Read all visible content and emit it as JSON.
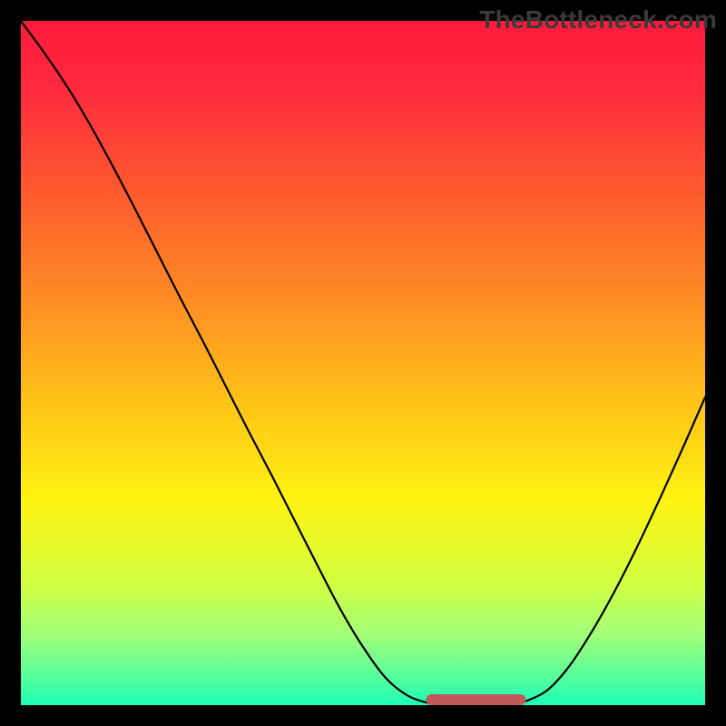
{
  "watermark": "TheBottleneck.com",
  "chart_data": {
    "type": "line",
    "title": "",
    "xlabel": "",
    "ylabel": "",
    "xlim": [
      0,
      100
    ],
    "ylim": [
      0,
      100
    ],
    "grid": false,
    "background_gradient": {
      "stops": [
        {
          "offset": 0.0,
          "color": "#ff1a3c"
        },
        {
          "offset": 0.1,
          "color": "#ff2a3e"
        },
        {
          "offset": 0.25,
          "color": "#ff5a2e"
        },
        {
          "offset": 0.4,
          "color": "#ff8a25"
        },
        {
          "offset": 0.55,
          "color": "#ffc018"
        },
        {
          "offset": 0.7,
          "color": "#fff312"
        },
        {
          "offset": 0.82,
          "color": "#d3ff40"
        },
        {
          "offset": 0.9,
          "color": "#9fff7a"
        },
        {
          "offset": 0.965,
          "color": "#4effa0"
        },
        {
          "offset": 1.0,
          "color": "#1dffb8"
        }
      ]
    },
    "series": [
      {
        "name": "bottleneck-curve",
        "color": "#000000",
        "x": [
          0.0,
          3.3,
          6.7,
          10.0,
          13.3,
          16.7,
          20.0,
          23.3,
          26.7,
          30.0,
          33.3,
          36.7,
          40.0,
          43.3,
          46.7,
          50.0,
          53.3,
          56.7,
          60.0,
          62.0,
          65.0,
          68.0,
          71.0,
          73.0,
          76.7,
          80.0,
          83.3,
          86.7,
          90.0,
          93.3,
          96.7,
          100.0
        ],
        "y": [
          100.0,
          95.5,
          90.5,
          85.0,
          79.0,
          72.5,
          66.0,
          59.5,
          53.0,
          46.5,
          40.0,
          33.5,
          27.0,
          20.5,
          14.0,
          8.5,
          4.0,
          1.3,
          0.2,
          0.0,
          0.0,
          0.0,
          0.0,
          0.3,
          2.0,
          5.5,
          10.5,
          16.5,
          23.0,
          30.0,
          37.5,
          45.0
        ]
      }
    ],
    "flat_band": {
      "color": "#c05a5a",
      "thickness": 2.4,
      "x_start": 60.0,
      "x_end": 73.0,
      "y": 0.0
    }
  }
}
